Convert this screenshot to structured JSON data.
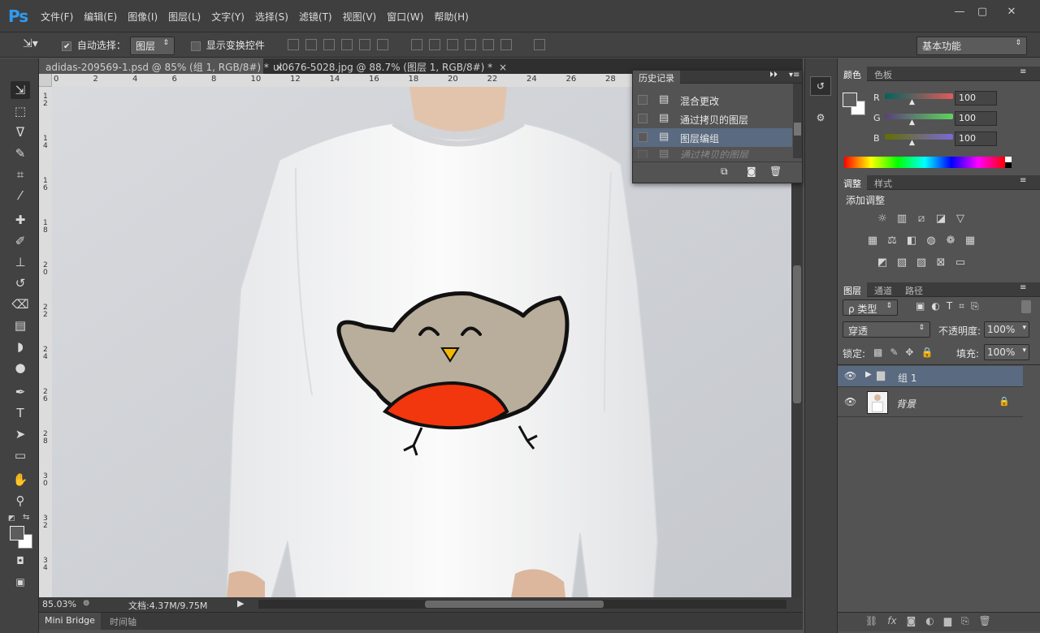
{
  "app": {
    "logo": "Ps"
  },
  "menu": [
    "文件(F)",
    "编辑(E)",
    "图像(I)",
    "图层(L)",
    "文字(Y)",
    "选择(S)",
    "滤镜(T)",
    "视图(V)",
    "窗口(W)",
    "帮助(H)"
  ],
  "window_controls": {
    "minimize": "—",
    "maximize": "▢",
    "close": "✕"
  },
  "options": {
    "auto_select_label": "自动选择：",
    "auto_select_checked": true,
    "auto_select_target": "图层",
    "show_transform_label": "显示变换控件",
    "workspace": "基本功能"
  },
  "tabs": [
    {
      "label": "adidas-209569-1.psd @ 85% (组 1, RGB/8#) *",
      "close": "×",
      "active": true
    },
    {
      "label": "ul0676-5028.jpg @ 88.7% (图层 1, RGB/8#) *",
      "close": "×",
      "active": false
    }
  ],
  "ruler": {
    "top": [
      "0",
      "2",
      "4",
      "6",
      "8",
      "10",
      "12",
      "14",
      "16",
      "18",
      "20",
      "22",
      "24",
      "26",
      "28"
    ],
    "left": [
      "1|2",
      "1|4",
      "1|6",
      "1|8",
      "2|0",
      "2|2",
      "2|4",
      "2|6",
      "2|8",
      "3|0",
      "3|2",
      "3|4"
    ]
  },
  "history": {
    "title": "历史记录",
    "items": [
      {
        "label": "混合更改",
        "selected": false,
        "dimmed": false
      },
      {
        "label": "通过拷贝的图层",
        "selected": false,
        "dimmed": false
      },
      {
        "label": "图层编组",
        "selected": true,
        "dimmed": false
      },
      {
        "label": "通过拷贝的图层",
        "selected": false,
        "dimmed": true
      }
    ]
  },
  "status": {
    "zoom": "85.03%",
    "doc": "文档:4.37M/9.75M"
  },
  "bottom_tabs": [
    "Mini Bridge",
    "时间轴"
  ],
  "color_panel": {
    "tabs": [
      "颜色",
      "色板"
    ],
    "channels": [
      {
        "label": "R",
        "value": "100"
      },
      {
        "label": "G",
        "value": "100"
      },
      {
        "label": "B",
        "value": "100"
      }
    ]
  },
  "adjust_panel": {
    "tabs": [
      "调整",
      "样式"
    ],
    "add_label": "添加调整"
  },
  "layers_panel": {
    "tabs": [
      "图层",
      "通道",
      "路径"
    ],
    "filter_kind": "ρ 类型",
    "blend_mode": "穿透",
    "opacity_label": "不透明度:",
    "opacity": "100%",
    "lock_label": "锁定:",
    "fill_label": "填充:",
    "fill": "100%",
    "layers": [
      {
        "name": "组 1",
        "type": "group",
        "selected": true
      },
      {
        "name": "背景",
        "type": "background",
        "selected": false
      }
    ]
  },
  "colors": {
    "accent": "#2f9bf1",
    "selected_row": "#5a6a80",
    "bird_body": "#b9ad9b",
    "bird_belly": "#f2360d",
    "beak": "#f5b800"
  }
}
